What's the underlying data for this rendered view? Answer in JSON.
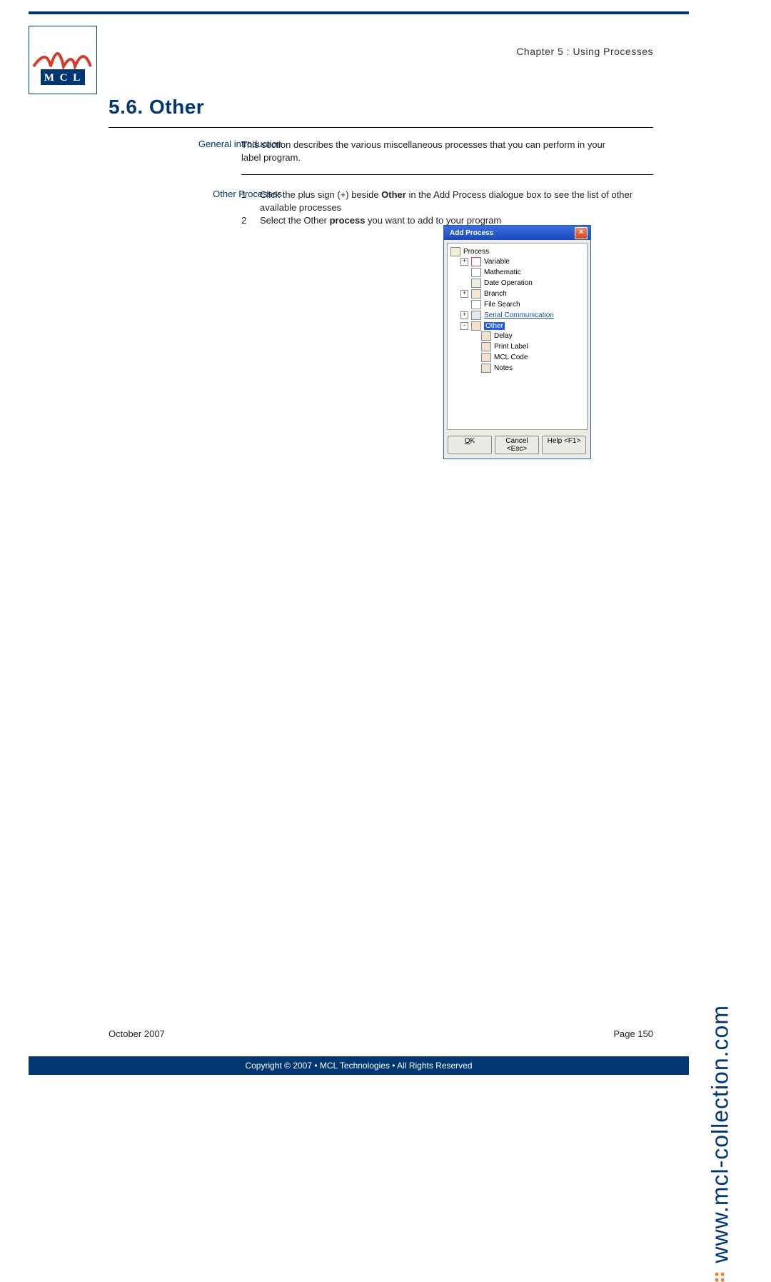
{
  "header": {
    "chapter": "Chapter 5 : Using Processes",
    "section_title": "5.6. Other"
  },
  "labels": {
    "general_intro": "General introduction",
    "other_processes": "Other Processes"
  },
  "body": {
    "general_intro": "This section describes the various miscellaneous processes that you can perform in your label program.",
    "steps": [
      {
        "num": "1",
        "pre": "Click the plus sign (+) beside ",
        "bold": "Other",
        "post": " in the Add Process dialogue box to see the list of other available processes"
      },
      {
        "num": "2",
        "pre": "Select the Other ",
        "bold": "process",
        "post": " you want to add to your program"
      }
    ]
  },
  "dialog": {
    "title": "Add Process",
    "close": "×",
    "tree": {
      "root": "Process",
      "items": [
        {
          "exp": "+",
          "icon": "var",
          "label": "Variable",
          "link": false
        },
        {
          "exp": "",
          "icon": "math",
          "label": "Mathematic",
          "link": false
        },
        {
          "exp": "",
          "icon": "date",
          "label": "Date Operation",
          "link": false
        },
        {
          "exp": "+",
          "icon": "branch",
          "label": "Branch",
          "link": false
        },
        {
          "exp": "",
          "icon": "file",
          "label": "File Search",
          "link": false
        },
        {
          "exp": "+",
          "icon": "serial",
          "label": "Serial Communication",
          "link": true
        },
        {
          "exp": "-",
          "icon": "other",
          "label": "Other",
          "selected": true,
          "children": [
            {
              "label": "Delay"
            },
            {
              "label": "Print Label"
            },
            {
              "label": "MCL Code"
            },
            {
              "label": "Notes"
            }
          ]
        }
      ]
    },
    "buttons": {
      "ok_u": "O",
      "ok_rest": "K",
      "cancel": "Cancel <Esc>",
      "help": "Help <F1>"
    }
  },
  "side_url": "www.mcl-collection.com",
  "footer": {
    "date": "October 2007",
    "page": "Page 150",
    "copyright": "Copyright © 2007 • MCL Technologies • All Rights Reserved"
  }
}
